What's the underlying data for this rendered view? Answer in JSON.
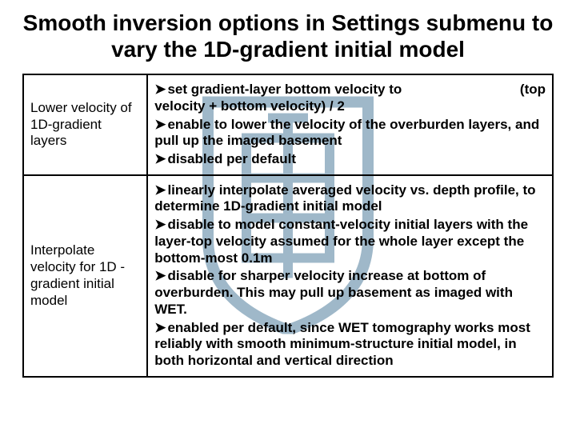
{
  "title": "Smooth inversion options in Settings submenu to vary the 1D-gradient initial model",
  "watermark": {
    "letter": "重"
  },
  "rows": [
    {
      "label": "Lower velocity of 1D-gradient layers",
      "items": [
        {
          "lead": "set gradient-layer bottom velocity to",
          "tail_right": "(top",
          "cont": "velocity + bottom velocity) / 2"
        },
        {
          "text": "enable to lower the velocity of the overburden layers, and pull up the imaged basement"
        },
        {
          "text": "disabled per default"
        }
      ]
    },
    {
      "label": "Interpolate velocity for 1D -gradient initial model",
      "items": [
        {
          "text": "linearly interpolate averaged velocity vs. depth profile, to determine 1D-gradient initial model"
        },
        {
          "text": "disable to model constant-velocity initial layers with the layer-top velocity assumed for the whole layer except the bottom-most 0.1m"
        },
        {
          "text": "disable for sharper velocity increase at bottom of overburden. This may pull up basement as imaged with WET."
        },
        {
          "text": "enabled per default, since WET tomography works most reliably with smooth minimum-structure initial model, in both horizontal and vertical direction"
        }
      ]
    }
  ]
}
